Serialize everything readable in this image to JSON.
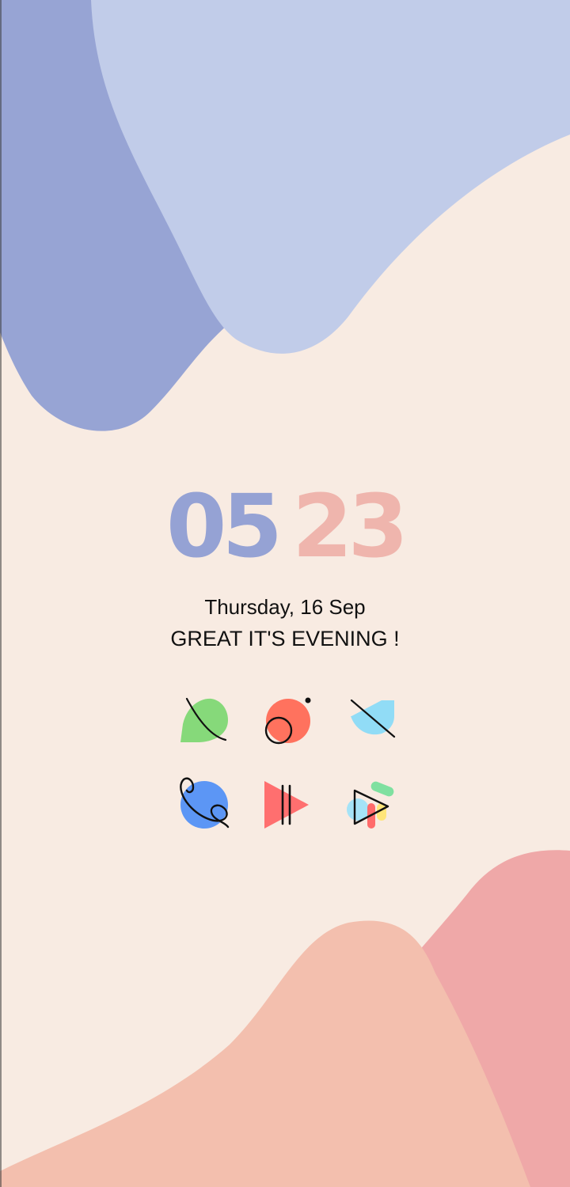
{
  "wallpaper": {
    "colors": {
      "cream": "#f8ebe2",
      "periwinkle_dark": "#97a4d4",
      "periwinkle_light": "#c1cce9",
      "peach": "#f3bfae",
      "pink": "#efa8a8"
    }
  },
  "clock": {
    "hours": "05",
    "minutes": "23",
    "hours_color": "#95a2d4",
    "minutes_color": "#efb5ad"
  },
  "date_text": "Thursday, 16 Sep",
  "greeting": "GREAT IT'S EVENING !",
  "apps": [
    {
      "icon": "leaf-icon",
      "color": "#86d97a"
    },
    {
      "icon": "camera-dot-icon",
      "color": "#ff725e"
    },
    {
      "icon": "half-circle-slash-icon",
      "color": "#91dcf6"
    },
    {
      "icon": "phone-icon",
      "color": "#5c96f5"
    },
    {
      "icon": "play-pause-icon",
      "color": "#ff6f6f"
    },
    {
      "icon": "play-store-icon",
      "color": "#7fe0a0"
    }
  ]
}
